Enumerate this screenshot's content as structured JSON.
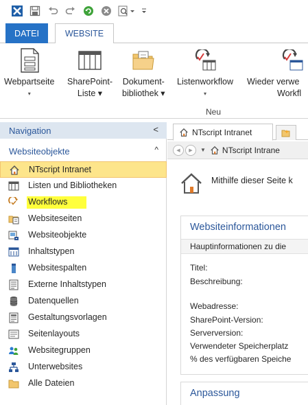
{
  "quick_access": {
    "icons": [
      "sharepoint-designer-logo-icon",
      "save-icon",
      "undo-icon",
      "redo-icon",
      "refresh-icon",
      "stop-icon",
      "preview-in-browser-icon",
      "customize-toolbar-icon"
    ]
  },
  "ribbon": {
    "tabs": {
      "file": "DATEI",
      "website": "WEBSITE"
    },
    "buttons": [
      {
        "line1": "Webpartseite",
        "line2": "▾",
        "icon": "webpart-page-icon"
      },
      {
        "line1": "SharePoint-",
        "line2": "Liste ▾",
        "icon": "sharepoint-list-icon"
      },
      {
        "line1": "Dokument-",
        "line2": "bibliothek ▾",
        "icon": "document-library-icon"
      },
      {
        "line1": "Listenworkflow",
        "line2": "▾",
        "icon": "list-workflow-icon"
      },
      {
        "line1": "Wieder verwe",
        "line2": "Workfl",
        "icon": "reusable-workflow-icon"
      }
    ],
    "group_label": "Neu"
  },
  "navigation": {
    "header": "Navigation",
    "header_arrow": "<",
    "section": "Websiteobjekte",
    "section_arrow": "^",
    "items": [
      {
        "label": "NTscript Intranet",
        "icon": "home-icon"
      },
      {
        "label": "Listen und Bibliotheken",
        "icon": "list-icon"
      },
      {
        "label": "Workflows",
        "icon": "workflow-icon"
      },
      {
        "label": "Websiteseiten",
        "icon": "site-pages-icon"
      },
      {
        "label": "Websiteobjekte",
        "icon": "site-assets-icon"
      },
      {
        "label": "Inhaltstypen",
        "icon": "content-types-icon"
      },
      {
        "label": "Websitespalten",
        "icon": "site-columns-icon"
      },
      {
        "label": "Externe Inhaltstypen",
        "icon": "external-content-types-icon"
      },
      {
        "label": "Datenquellen",
        "icon": "data-sources-icon"
      },
      {
        "label": "Gestaltungsvorlagen",
        "icon": "master-pages-icon"
      },
      {
        "label": "Seitenlayouts",
        "icon": "page-layouts-icon"
      },
      {
        "label": "Websitegruppen",
        "icon": "site-groups-icon"
      },
      {
        "label": "Unterwebsites",
        "icon": "subsites-icon"
      },
      {
        "label": "Alle Dateien",
        "icon": "all-files-icon"
      }
    ]
  },
  "main": {
    "doc_tab": "NTscript Intranet",
    "breadcrumb": "NTscript Intrane",
    "intro": "Mithilfe dieser Seite k",
    "info": {
      "title": "Websiteinformationen",
      "subheader": "Hauptinformationen zu die",
      "fields": [
        "Titel:",
        "Beschreibung:",
        "Webadresse:",
        "SharePoint-Version:",
        "Serverversion:",
        "Verwendeter Speicherplatz",
        "% des verfügbaren Speiche"
      ]
    },
    "next_section": "Anpassung"
  },
  "colors": {
    "accent": "#2b579a",
    "file_tab": "#2672c6",
    "selected_bg": "#fde58b",
    "highlight": "#ffff3c",
    "nav_header_bg": "#dde6f0"
  }
}
